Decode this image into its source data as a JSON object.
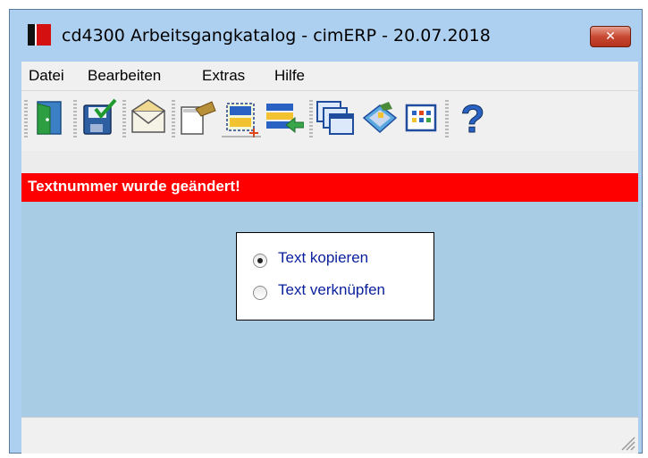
{
  "window": {
    "title": "cd4300 Arbeitsgangkatalog - cimERP - 20.07.2018",
    "close_label": "✕"
  },
  "menu": {
    "items": [
      "Datei",
      "Bearbeiten",
      "Extras",
      "Hilfe"
    ]
  },
  "toolbar": {
    "buttons": [
      {
        "icon": "exit-door-icon"
      },
      {
        "icon": "save-icon"
      },
      {
        "icon": "mail-icon"
      },
      {
        "icon": "copy-paste-icon"
      },
      {
        "icon": "new-selection-icon"
      },
      {
        "icon": "import-list-icon"
      },
      {
        "icon": "windows-icon"
      },
      {
        "icon": "book-icon"
      },
      {
        "icon": "grid-view-icon"
      },
      {
        "icon": "help-icon"
      }
    ]
  },
  "banner": {
    "text": "Textnummer wurde geändert!",
    "color": "#ff0000"
  },
  "options": {
    "selected": "copy",
    "items": [
      {
        "label": "Text kopieren",
        "checked": true
      },
      {
        "label": "Text verknüpfen",
        "checked": false
      }
    ]
  },
  "colors": {
    "content_bg": "#a8cce4",
    "label_text": "#0a1f9c"
  }
}
